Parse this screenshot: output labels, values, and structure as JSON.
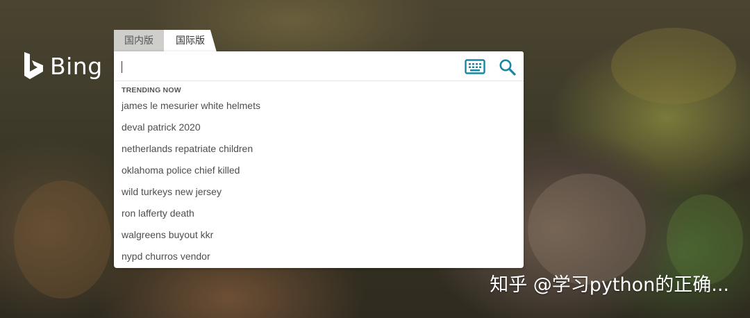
{
  "logo": {
    "text": "Bing",
    "icon": "bing-b-icon"
  },
  "tabs": [
    {
      "label": "国内版",
      "active": false
    },
    {
      "label": "国际版",
      "active": true
    }
  ],
  "search": {
    "value": "",
    "placeholder": "",
    "keyboard_icon": "keyboard-icon",
    "search_icon": "search-icon"
  },
  "suggestions": {
    "heading": "TRENDING NOW",
    "items": [
      "james le mesurier white helmets",
      "deval patrick 2020",
      "netherlands repatriate children",
      "oklahoma police chief killed",
      "wild turkeys new jersey",
      "ron lafferty death",
      "walgreens buyout kkr",
      "nypd churros vendor"
    ]
  },
  "watermark": "知乎 @学习python的正确...",
  "colors": {
    "accent": "#1b86a3",
    "background": "#3d3a2a"
  }
}
